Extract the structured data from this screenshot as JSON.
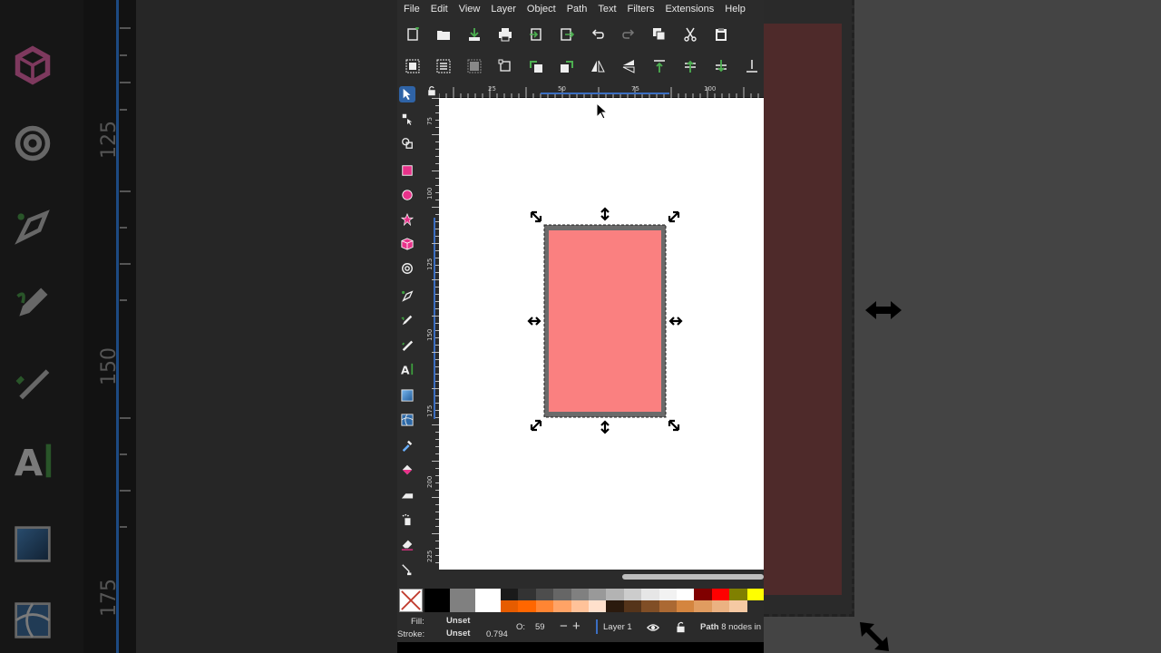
{
  "menu": [
    "File",
    "Edit",
    "View",
    "Layer",
    "Object",
    "Path",
    "Text",
    "Filters",
    "Extensions",
    "Help"
  ],
  "toolbar1_icons": [
    "new-document-icon",
    "open-icon",
    "save-icon",
    "print-icon",
    "import-icon",
    "export-icon",
    "undo-icon",
    "redo-icon",
    "copy-icon",
    "cut-icon",
    "paste-icon"
  ],
  "toolbar2_icons": [
    "select-all-icon",
    "select-all-layers-icon",
    "deselect-icon",
    "transform-bbox-icon",
    "rotate-ccw-icon",
    "rotate-cw-icon",
    "flip-horizontal-icon",
    "flip-vertical-icon",
    "raise-to-top-icon",
    "raise-icon",
    "lower-icon",
    "lower-to-bottom-icon"
  ],
  "tools": [
    "selector",
    "node",
    "tweak",
    "rectangle",
    "ellipse",
    "star",
    "3d-box",
    "spiral",
    "pen",
    "pencil",
    "calligraphy",
    "text",
    "gradient",
    "mesh",
    "dropper",
    "paint-bucket",
    "spray",
    "eraser",
    "eraser-2",
    "connector"
  ],
  "ruler": {
    "h_labels": [
      "25",
      "50",
      "75",
      "100"
    ],
    "v_labels": [
      "75",
      "100",
      "125",
      "150",
      "175",
      "200",
      "225"
    ]
  },
  "left_bg_labels": [
    "125",
    "150",
    "175"
  ],
  "shape": {
    "fill": "#fa8080",
    "stroke": "#6b6b6b"
  },
  "palette": {
    "top": [
      "#1a1a1a",
      "#333333",
      "#4d4d4d",
      "#666666",
      "#808080",
      "#999999",
      "#b3b3b3",
      "#cccccc",
      "#e6e6e6",
      "#f2f2f2",
      "#ffffff",
      "#800000",
      "#ff0000",
      "#808000",
      "#ffff00"
    ],
    "bottom": [
      "#e65c00",
      "#ff6600",
      "#ff8533",
      "#ffa366",
      "#ffc299",
      "#ffe0cc",
      "#2b1a0d",
      "#55341a",
      "#804e26",
      "#ab6933",
      "#d4853f",
      "#e09c60",
      "#ebb282",
      "#f5c9a3"
    ],
    "big": [
      "#000000",
      "#808080",
      "#ffffff"
    ]
  },
  "status": {
    "fill_label": "Fill:",
    "fill_value": "Unset",
    "stroke_label": "Stroke:",
    "stroke_value": "Unset",
    "stroke_width": "0.794",
    "opacity_label": "O:",
    "opacity_value": "59",
    "layer": "Layer 1",
    "message_bold": "Path",
    "message": "8 nodes in"
  }
}
